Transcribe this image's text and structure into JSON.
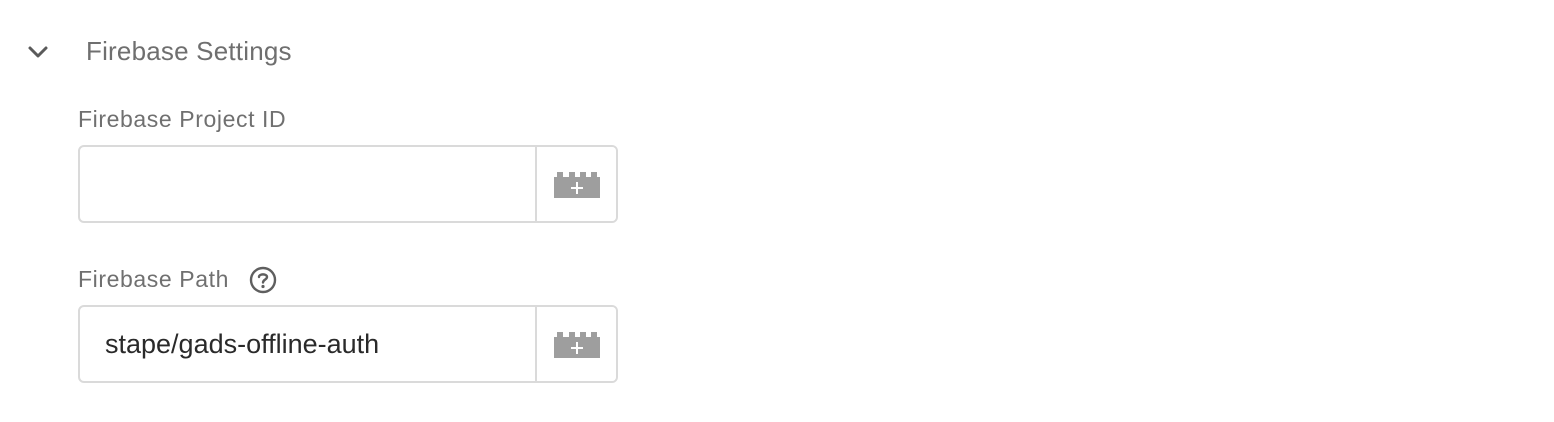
{
  "section": {
    "title": "Firebase Settings",
    "chevron_icon": "chevron-down-icon"
  },
  "fields": [
    {
      "label": "Firebase Project ID",
      "value": "",
      "placeholder": "",
      "variable_icon": "add-variable-block-icon"
    },
    {
      "label": "Firebase Path",
      "value": "stape/gads-offline-auth",
      "placeholder": "",
      "help_icon": "help-circle-icon",
      "variable_icon": "add-variable-block-icon"
    }
  ],
  "colors": {
    "text_muted": "#707070",
    "text_value": "#2a2a2a",
    "border": "#dadada",
    "icon_gray": "#9e9e9e"
  }
}
